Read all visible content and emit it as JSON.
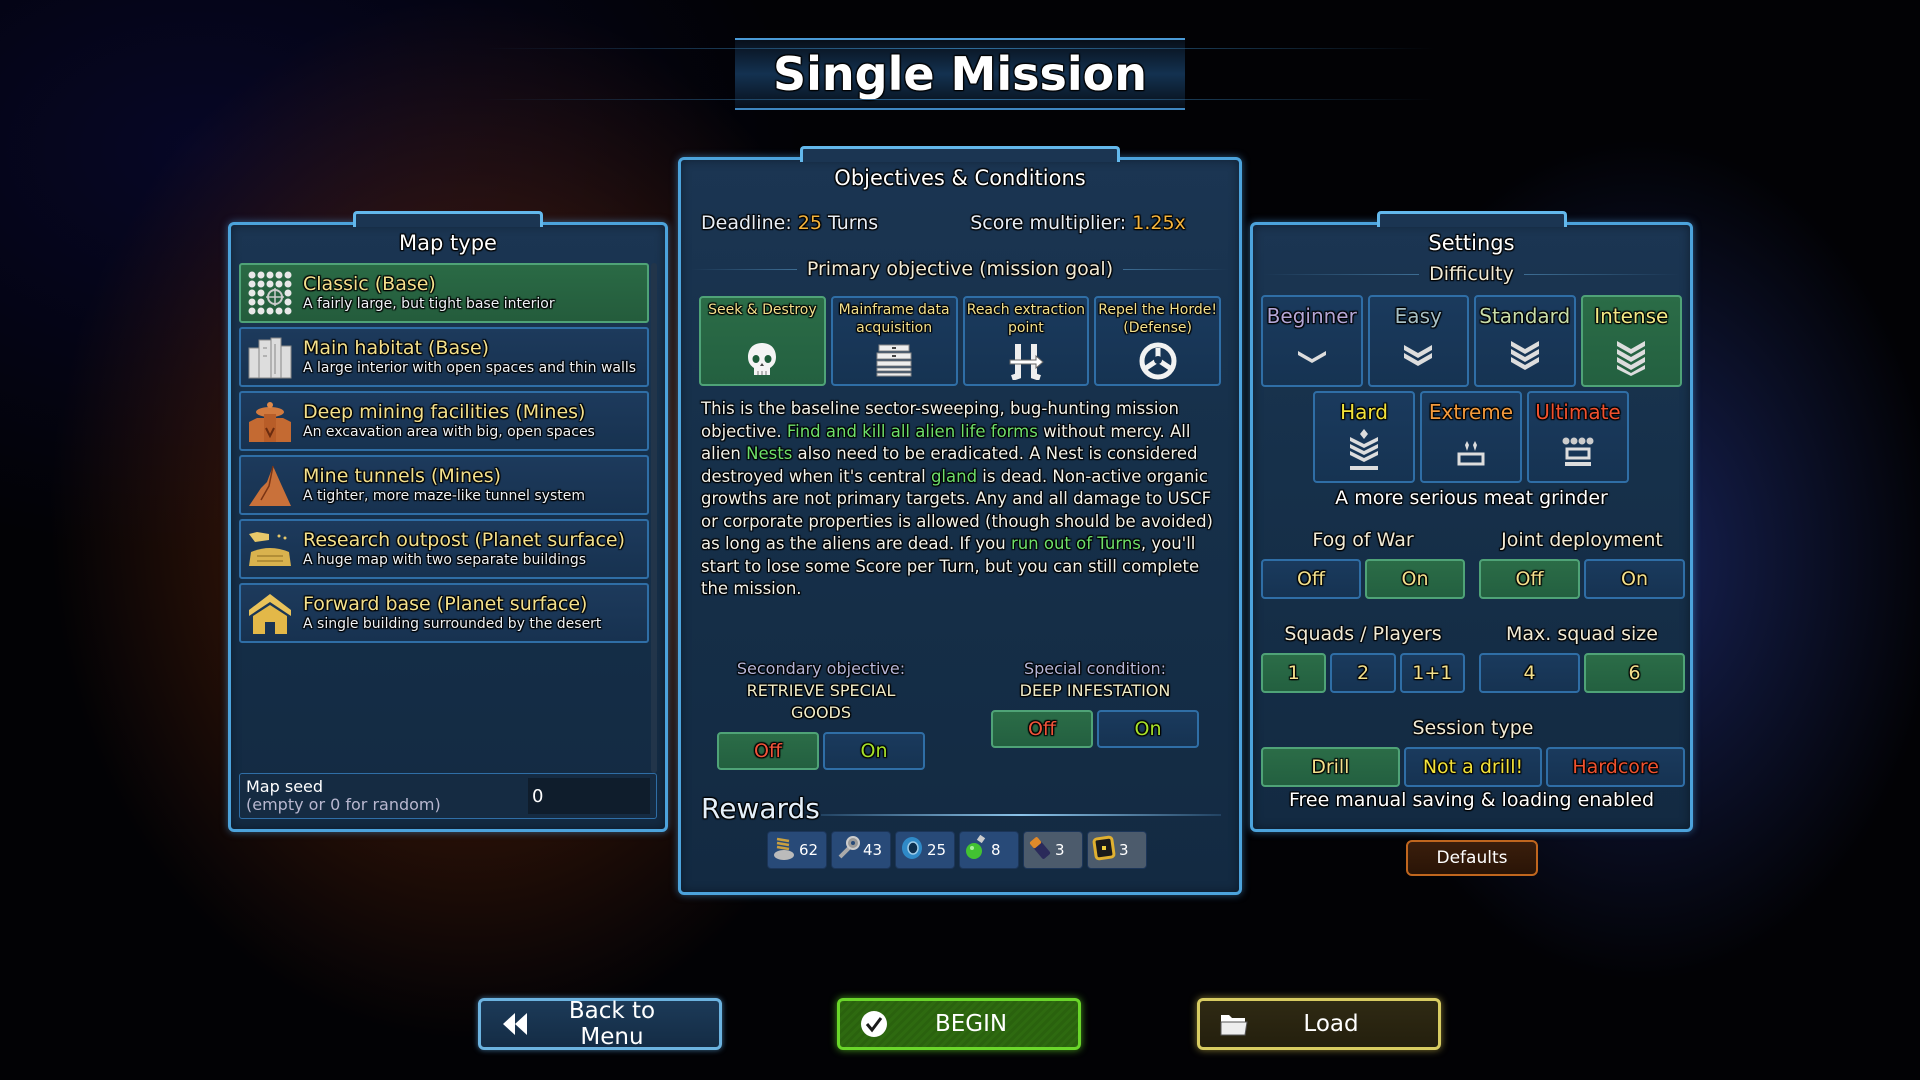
{
  "title": "Single Mission",
  "map_panel": {
    "title": "Map type",
    "items": [
      {
        "name": "Classic (Base)",
        "desc": "A fairly large, but tight base interior",
        "icon": "grid-dots-icon",
        "selected": true
      },
      {
        "name": "Main habitat (Base)",
        "desc": "A large interior with open spaces and thin walls",
        "icon": "habitat-building-icon",
        "selected": false
      },
      {
        "name": "Deep mining facilities (Mines)",
        "desc": "An excavation area with big, open spaces",
        "icon": "mining-tower-icon",
        "selected": false
      },
      {
        "name": "Mine tunnels (Mines)",
        "desc": "A tighter, more maze-like tunnel system",
        "icon": "mountain-icon",
        "selected": false
      },
      {
        "name": "Research outpost (Planet surface)",
        "desc": "A huge map with two separate buildings",
        "icon": "outpost-icon",
        "selected": false
      },
      {
        "name": "Forward base (Planet surface)",
        "desc": "A single building surrounded by the desert",
        "icon": "house-icon",
        "selected": false
      }
    ],
    "seed_label": "Map seed",
    "seed_hint": "(empty or 0 for random)",
    "seed_value": "0"
  },
  "objectives_panel": {
    "title": "Objectives & Conditions",
    "deadline_label": "Deadline:",
    "deadline_value": "25",
    "deadline_unit": "Turns",
    "score_label": "Score multiplier:",
    "score_value": "1.25x",
    "primary_label": "Primary objective (mission goal)",
    "objectives": [
      {
        "label": "Seek & Destroy",
        "icon": "skull-icon",
        "selected": true
      },
      {
        "label": "Mainframe data acquisition",
        "icon": "data-stack-icon",
        "selected": false
      },
      {
        "label": "Reach extraction point",
        "icon": "extraction-icon",
        "selected": false
      },
      {
        "label": "Repel the Horde! (Defense)",
        "icon": "defense-shield-icon",
        "selected": false
      }
    ],
    "description": {
      "p1": "This is the baseline sector-sweeping, bug-hunting mission objective. ",
      "h1": "Find and kill all alien life forms",
      "p2": " without mercy. All alien ",
      "h2": "Nests",
      "p3": " also need to be eradicated. A Nest is considered destroyed when it's central ",
      "h3": "gland",
      "p4": " is dead. Non-active organic growths are not primary targets. Any and all damage to USCF or corporate properties is allowed (though should be avoided) as long as the aliens are dead. If you ",
      "h4": "run out of Turns",
      "p5": ", you'll start to lose some Score per Turn, but you can still complete the mission."
    },
    "secondary": {
      "title": "Secondary objective:",
      "value": "RETRIEVE SPECIAL GOODS",
      "off": "Off",
      "on": "On",
      "selected": "Off"
    },
    "special": {
      "title": "Special condition:",
      "value": "DEEP INFESTATION",
      "off": "Off",
      "on": "On",
      "selected": "Off"
    },
    "rewards_title": "Rewards",
    "rewards": [
      {
        "icon": "coil-icon",
        "count": "62"
      },
      {
        "icon": "bolt-nut-icon",
        "count": "43"
      },
      {
        "icon": "tape-roll-icon",
        "count": "25"
      },
      {
        "icon": "green-flask-icon",
        "count": "8"
      },
      {
        "icon": "battery-icon",
        "count": "3"
      },
      {
        "icon": "chip-icon",
        "count": "3"
      }
    ]
  },
  "settings_panel": {
    "title": "Settings",
    "difficulty_label": "Difficulty",
    "difficulties": [
      {
        "label": "Beginner",
        "color": "#b3a6d6",
        "selected": false
      },
      {
        "label": "Easy",
        "color": "#a6bfc4",
        "selected": false
      },
      {
        "label": "Standard",
        "color": "#c7dca8",
        "selected": false
      },
      {
        "label": "Intense",
        "color": "#f1e884",
        "selected": true
      },
      {
        "label": "Hard",
        "color": "#f2e23a",
        "selected": false
      },
      {
        "label": "Extreme",
        "color": "#f39a3c",
        "selected": false
      },
      {
        "label": "Ultimate",
        "color": "#f0512e",
        "selected": false
      }
    ],
    "difficulty_desc": "A more serious meat grinder",
    "fog_label": "Fog of War",
    "fog_options": [
      "Off",
      "On"
    ],
    "fog_selected": "On",
    "joint_label": "Joint deployment",
    "joint_options": [
      "Off",
      "On"
    ],
    "joint_selected": "Off",
    "squads_label": "Squads / Players",
    "squads_options": [
      "1",
      "2",
      "1+1"
    ],
    "squads_selected": "1",
    "squad_size_label": "Max. squad size",
    "squad_size_options": [
      "4",
      "6"
    ],
    "squad_size_selected": "6",
    "session_label": "Session type",
    "session_options": [
      {
        "label": "Drill",
        "color": "#f3e08c"
      },
      {
        "label": "Not a drill!",
        "color": "#f2e23a"
      },
      {
        "label": "Hardcore",
        "color": "#f0512e"
      }
    ],
    "session_selected": "Drill",
    "session_desc": "Free manual saving & loading enabled",
    "defaults_label": "Defaults"
  },
  "footer": {
    "back_label": "Back to Menu",
    "begin_label": "BEGIN",
    "load_label": "Load"
  }
}
